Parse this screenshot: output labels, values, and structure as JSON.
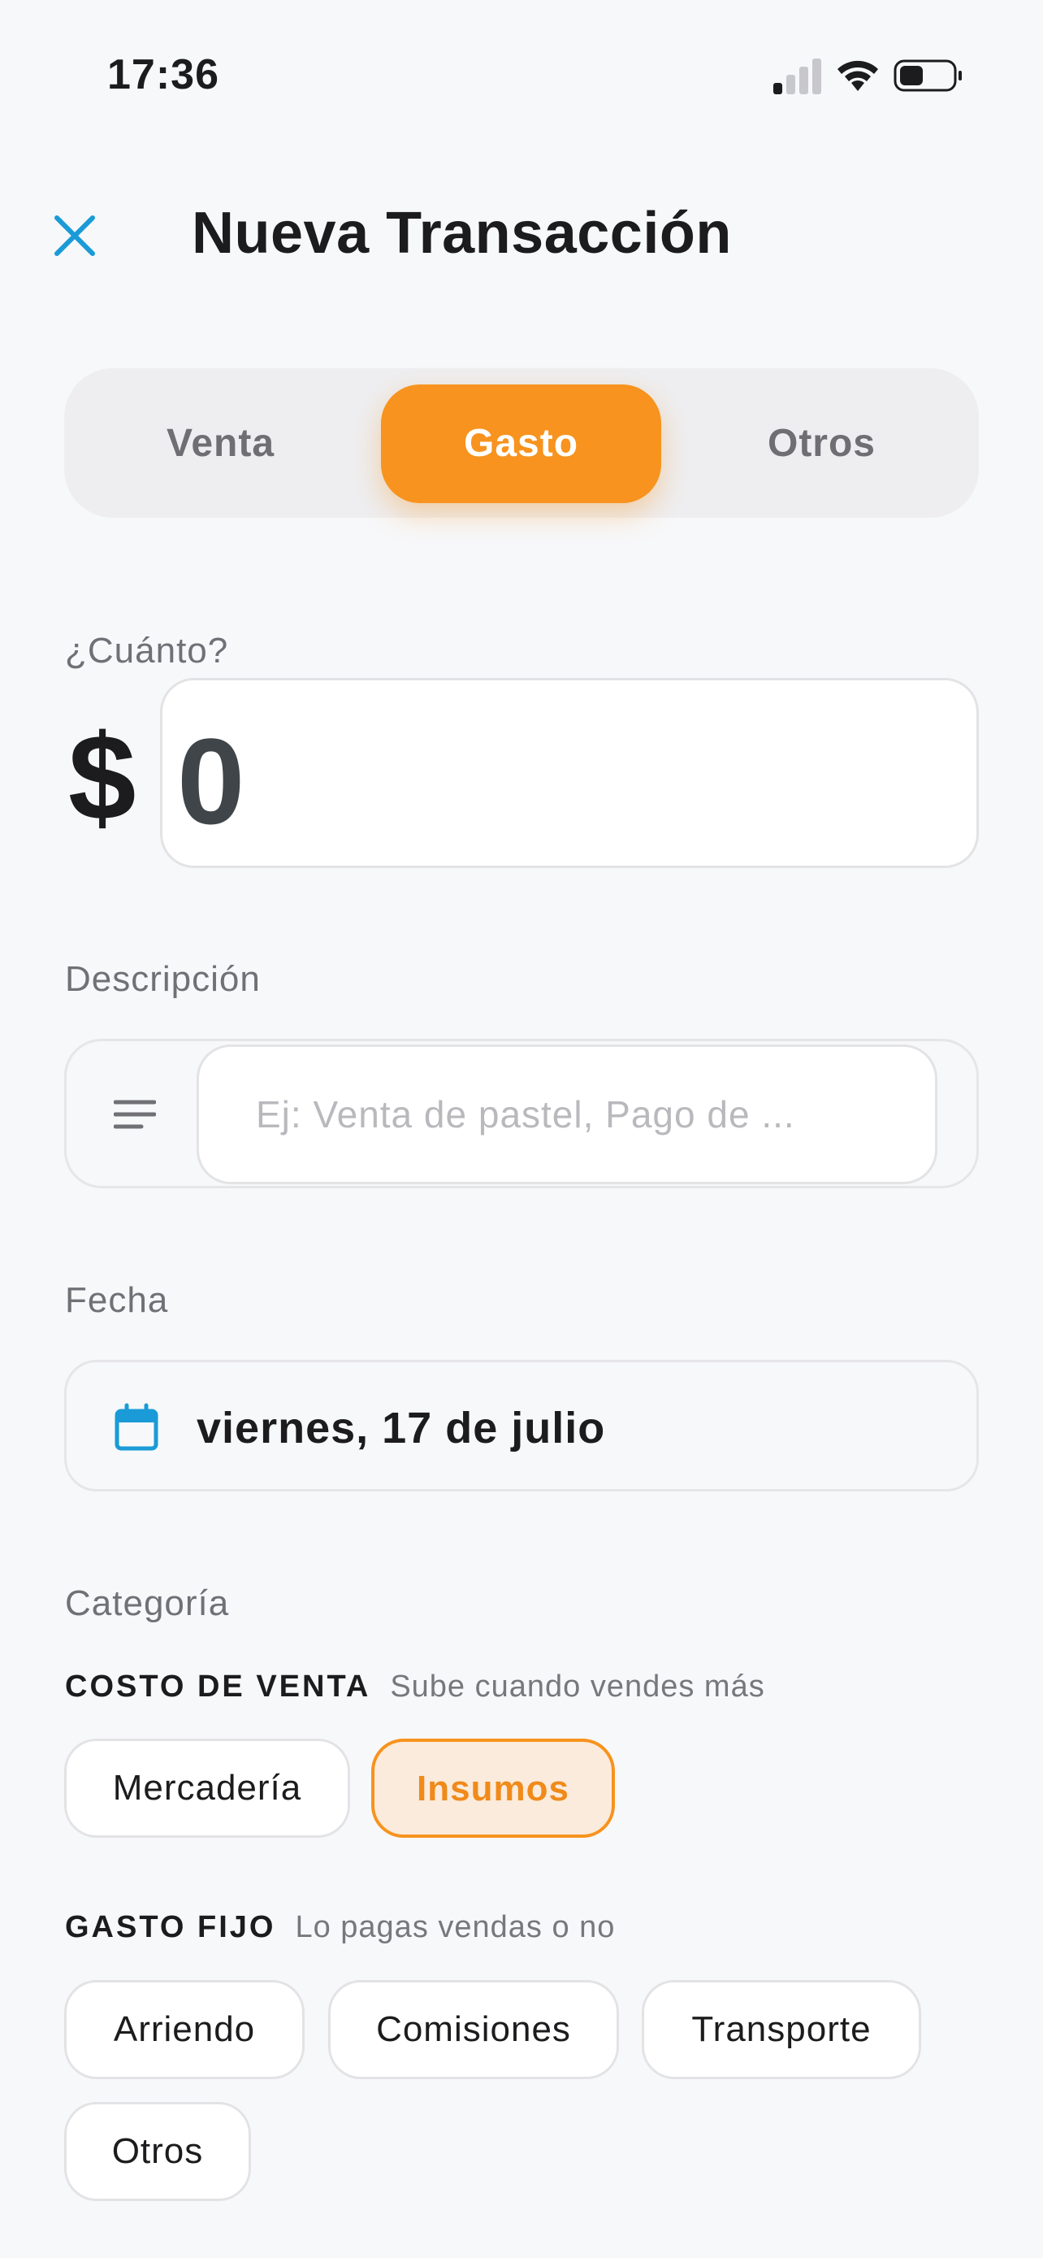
{
  "status_bar": {
    "time": "17:36"
  },
  "header": {
    "title": "Nueva Transacción"
  },
  "segments": [
    {
      "label": "Venta",
      "selected": false
    },
    {
      "label": "Gasto",
      "selected": true
    },
    {
      "label": "Otros",
      "selected": false
    }
  ],
  "amount": {
    "label": "¿Cuánto?",
    "currency": "$",
    "value": "0"
  },
  "description": {
    "label": "Descripción",
    "placeholder": "Ej: Venta de pastel, Pago de ..."
  },
  "date": {
    "label": "Fecha",
    "value": "viernes, 17 de julio"
  },
  "category": {
    "label": "Categoría",
    "groups": [
      {
        "title": "COSTO DE VENTA",
        "subtitle": "Sube cuando vendes más",
        "chips": [
          {
            "label": "Mercadería",
            "selected": false
          },
          {
            "label": "Insumos",
            "selected": true
          }
        ]
      },
      {
        "title": "GASTO FIJO",
        "subtitle": "Lo pagas vendas o no",
        "chips": [
          {
            "label": "Arriendo",
            "selected": false
          },
          {
            "label": "Comisiones",
            "selected": false
          },
          {
            "label": "Transporte",
            "selected": false
          },
          {
            "label": "Otros",
            "selected": false
          }
        ]
      }
    ]
  },
  "colors": {
    "accent": "#f7931e",
    "icon_blue": "#1a9bd7",
    "background": "#f7f8fa"
  },
  "icons": {
    "close": "close-icon",
    "description": "text-lines-icon",
    "date": "calendar-icon"
  }
}
